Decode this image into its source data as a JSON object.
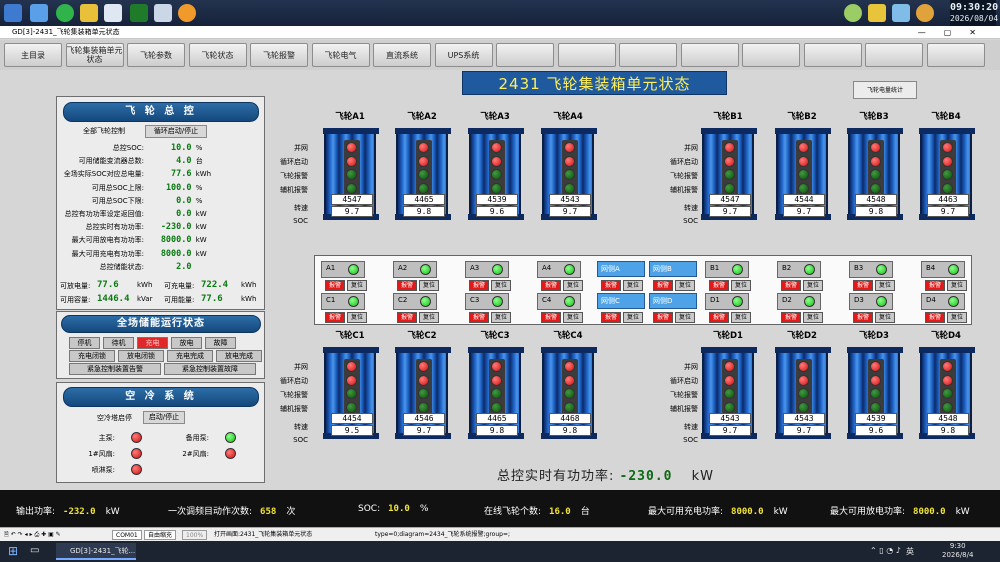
{
  "clock": {
    "time": "09:30:20",
    "date": "2026/08/04"
  },
  "window": {
    "title": "GD[3]-2431_飞轮集装箱单元状态"
  },
  "nav": [
    "主目录",
    "飞轮集装箱单元状态",
    "飞轮参数",
    "飞轮状态",
    "飞轮报警",
    "飞轮电气",
    "直流系统",
    "UPS系统",
    "",
    "",
    "",
    "",
    "",
    "",
    "",
    ""
  ],
  "page_title": "2431  飞轮集装箱单元状态",
  "flow_button": "飞轮电量统计",
  "master": {
    "title": "飞 轮 总 控",
    "tabs": [
      "全部飞轮控制",
      "循环启动/停止"
    ],
    "rows": [
      {
        "label": "总控SOC:",
        "value": "10.0",
        "unit": "%"
      },
      {
        "label": "可用储能变流器总数:",
        "value": "4.0",
        "unit": "台"
      },
      {
        "label": "全场实际SOC对应总电量:",
        "value": "77.6",
        "unit": "kWh"
      },
      {
        "label": "可用总SOC上限:",
        "value": "100.0",
        "unit": "%"
      },
      {
        "label": "可用总SOC下限:",
        "value": "0.0",
        "unit": "%"
      },
      {
        "label": "总控有功功率设定返回值:",
        "value": "0.0",
        "unit": "kW"
      },
      {
        "label": "总控实时有功功率:",
        "value": "-230.0",
        "unit": "kW"
      },
      {
        "label": "最大可用放电有功功率:",
        "value": "8000.0",
        "unit": "kW"
      },
      {
        "label": "最大可用充电有功功率:",
        "value": "8000.0",
        "unit": "kW"
      },
      {
        "label": "总控储能状态:",
        "value": "2.0",
        "unit": ""
      }
    ],
    "bottom": [
      {
        "label": "可放电量:",
        "value": "77.6",
        "unit": "kWh"
      },
      {
        "label": "可充电量:",
        "value": "722.4",
        "unit": "kWh"
      },
      {
        "label": "可用容量:",
        "value": "1446.4",
        "unit": "kVar"
      },
      {
        "label": "可用能量:",
        "value": "77.6",
        "unit": "kWh"
      }
    ]
  },
  "station": {
    "title": "全场储能运行状态",
    "tiles": [
      [
        "停机",
        "待机",
        "充电",
        "放电",
        "故障"
      ],
      [
        "充电闭锁",
        "放电闭锁",
        "充电完成",
        "放电完成"
      ],
      [
        "紧急控制装置告警",
        "紧急控制装置故障"
      ]
    ],
    "active": "充电"
  },
  "cooling": {
    "title": "空 冷 系 统",
    "label": "空冷塔启停",
    "button": "启动/停止",
    "items": [
      {
        "label": "主泵:",
        "state": "red"
      },
      {
        "label": "备用泵:",
        "state": "green"
      },
      {
        "label": "1#风扇:",
        "state": "red"
      },
      {
        "label": "2#风扇:",
        "state": "red"
      },
      {
        "label": "喷淋泵:",
        "state": "red"
      }
    ]
  },
  "status_labels": [
    "并网",
    "循环启动",
    "飞轮报警",
    "辅机报警"
  ],
  "speed_labels": [
    "转速",
    "SOC"
  ],
  "flywheels_top": [
    {
      "name": "飞轮A1",
      "speed": "4547",
      "soc": "9.7"
    },
    {
      "name": "飞轮A2",
      "speed": "4465",
      "soc": "9.8"
    },
    {
      "name": "飞轮A3",
      "speed": "4539",
      "soc": "9.6"
    },
    {
      "name": "飞轮A4",
      "speed": "4543",
      "soc": "9.7"
    },
    {
      "name": "飞轮B1",
      "speed": "4547",
      "soc": "9.7"
    },
    {
      "name": "飞轮B2",
      "speed": "4544",
      "soc": "9.7"
    },
    {
      "name": "飞轮B3",
      "speed": "4548",
      "soc": "9.8"
    },
    {
      "name": "飞轮B4",
      "speed": "4463",
      "soc": "9.7"
    }
  ],
  "flywheels_bottom": [
    {
      "name": "飞轮C1",
      "speed": "4454",
      "soc": "9.5"
    },
    {
      "name": "飞轮C2",
      "speed": "4546",
      "soc": "9.7"
    },
    {
      "name": "飞轮C3",
      "speed": "4465",
      "soc": "9.8"
    },
    {
      "name": "飞轮C4",
      "speed": "4468",
      "soc": "9.8"
    },
    {
      "name": "飞轮D1",
      "speed": "4543",
      "soc": "9.7"
    },
    {
      "name": "飞轮D2",
      "speed": "4543",
      "soc": "9.7"
    },
    {
      "name": "飞轮D3",
      "speed": "4539",
      "soc": "9.6"
    },
    {
      "name": "飞轮D4",
      "speed": "4548",
      "soc": "9.8"
    }
  ],
  "mid": {
    "row1": [
      "A1",
      "A2",
      "A3",
      "A4",
      "B1",
      "B2",
      "B3",
      "B4"
    ],
    "row2": [
      "C1",
      "C2",
      "C3",
      "C4",
      "D1",
      "D2",
      "D3",
      "D4"
    ],
    "net": [
      "网侧A",
      "网侧B",
      "网侧C",
      "网侧D"
    ],
    "btn_on": "报警",
    "btn_reset": "复位"
  },
  "total": {
    "label": "总控实时有功功率:",
    "value": "-230.0",
    "unit": "kW"
  },
  "status_bar": [
    {
      "label": "输出功率:",
      "value": "-232.0",
      "unit": "kW"
    },
    {
      "label": "一次调频目动作次数:",
      "value": "658",
      "unit": "次"
    },
    {
      "label": "SOC:",
      "value": "10.0",
      "unit": "%"
    },
    {
      "label": "在线飞轮个数:",
      "value": "16.0",
      "unit": "台"
    },
    {
      "label": "最大可用充电功率:",
      "value": "8000.0",
      "unit": "kW"
    },
    {
      "label": "最大可用放电功率:",
      "value": "8000.0",
      "unit": "kW"
    }
  ],
  "toolbar": {
    "combo1": "COM01",
    "combo2": "自由缩充",
    "zoom": "100%",
    "msg": "打开画面:2431_飞轮集装箱单元状态",
    "diag": "type=0;diagram=2434_飞轮系统报警;group=;"
  },
  "taskbar": {
    "app": "GD[3]-2431_飞轮...",
    "lang": "英",
    "time": "9:30",
    "date": "2026/8/4"
  }
}
